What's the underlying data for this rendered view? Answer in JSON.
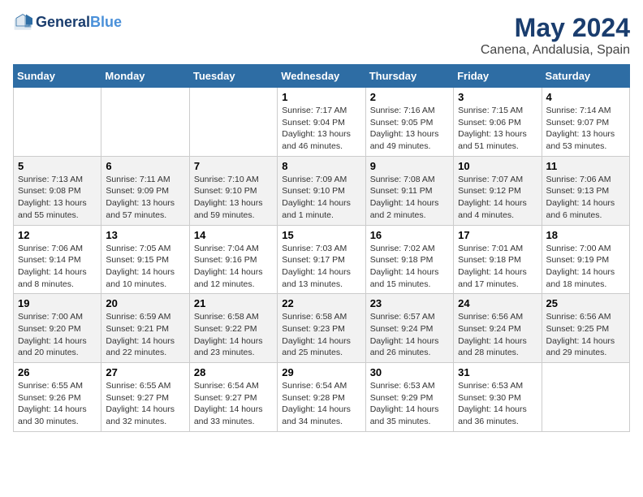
{
  "header": {
    "logo_line1": "General",
    "logo_line2": "Blue",
    "month": "May 2024",
    "location": "Canena, Andalusia, Spain"
  },
  "weekdays": [
    "Sunday",
    "Monday",
    "Tuesday",
    "Wednesday",
    "Thursday",
    "Friday",
    "Saturday"
  ],
  "weeks": [
    [
      {
        "day": "",
        "sunrise": "",
        "sunset": "",
        "daylight": ""
      },
      {
        "day": "",
        "sunrise": "",
        "sunset": "",
        "daylight": ""
      },
      {
        "day": "",
        "sunrise": "",
        "sunset": "",
        "daylight": ""
      },
      {
        "day": "1",
        "sunrise": "Sunrise: 7:17 AM",
        "sunset": "Sunset: 9:04 PM",
        "daylight": "Daylight: 13 hours and 46 minutes."
      },
      {
        "day": "2",
        "sunrise": "Sunrise: 7:16 AM",
        "sunset": "Sunset: 9:05 PM",
        "daylight": "Daylight: 13 hours and 49 minutes."
      },
      {
        "day": "3",
        "sunrise": "Sunrise: 7:15 AM",
        "sunset": "Sunset: 9:06 PM",
        "daylight": "Daylight: 13 hours and 51 minutes."
      },
      {
        "day": "4",
        "sunrise": "Sunrise: 7:14 AM",
        "sunset": "Sunset: 9:07 PM",
        "daylight": "Daylight: 13 hours and 53 minutes."
      }
    ],
    [
      {
        "day": "5",
        "sunrise": "Sunrise: 7:13 AM",
        "sunset": "Sunset: 9:08 PM",
        "daylight": "Daylight: 13 hours and 55 minutes."
      },
      {
        "day": "6",
        "sunrise": "Sunrise: 7:11 AM",
        "sunset": "Sunset: 9:09 PM",
        "daylight": "Daylight: 13 hours and 57 minutes."
      },
      {
        "day": "7",
        "sunrise": "Sunrise: 7:10 AM",
        "sunset": "Sunset: 9:10 PM",
        "daylight": "Daylight: 13 hours and 59 minutes."
      },
      {
        "day": "8",
        "sunrise": "Sunrise: 7:09 AM",
        "sunset": "Sunset: 9:10 PM",
        "daylight": "Daylight: 14 hours and 1 minute."
      },
      {
        "day": "9",
        "sunrise": "Sunrise: 7:08 AM",
        "sunset": "Sunset: 9:11 PM",
        "daylight": "Daylight: 14 hours and 2 minutes."
      },
      {
        "day": "10",
        "sunrise": "Sunrise: 7:07 AM",
        "sunset": "Sunset: 9:12 PM",
        "daylight": "Daylight: 14 hours and 4 minutes."
      },
      {
        "day": "11",
        "sunrise": "Sunrise: 7:06 AM",
        "sunset": "Sunset: 9:13 PM",
        "daylight": "Daylight: 14 hours and 6 minutes."
      }
    ],
    [
      {
        "day": "12",
        "sunrise": "Sunrise: 7:06 AM",
        "sunset": "Sunset: 9:14 PM",
        "daylight": "Daylight: 14 hours and 8 minutes."
      },
      {
        "day": "13",
        "sunrise": "Sunrise: 7:05 AM",
        "sunset": "Sunset: 9:15 PM",
        "daylight": "Daylight: 14 hours and 10 minutes."
      },
      {
        "day": "14",
        "sunrise": "Sunrise: 7:04 AM",
        "sunset": "Sunset: 9:16 PM",
        "daylight": "Daylight: 14 hours and 12 minutes."
      },
      {
        "day": "15",
        "sunrise": "Sunrise: 7:03 AM",
        "sunset": "Sunset: 9:17 PM",
        "daylight": "Daylight: 14 hours and 13 minutes."
      },
      {
        "day": "16",
        "sunrise": "Sunrise: 7:02 AM",
        "sunset": "Sunset: 9:18 PM",
        "daylight": "Daylight: 14 hours and 15 minutes."
      },
      {
        "day": "17",
        "sunrise": "Sunrise: 7:01 AM",
        "sunset": "Sunset: 9:18 PM",
        "daylight": "Daylight: 14 hours and 17 minutes."
      },
      {
        "day": "18",
        "sunrise": "Sunrise: 7:00 AM",
        "sunset": "Sunset: 9:19 PM",
        "daylight": "Daylight: 14 hours and 18 minutes."
      }
    ],
    [
      {
        "day": "19",
        "sunrise": "Sunrise: 7:00 AM",
        "sunset": "Sunset: 9:20 PM",
        "daylight": "Daylight: 14 hours and 20 minutes."
      },
      {
        "day": "20",
        "sunrise": "Sunrise: 6:59 AM",
        "sunset": "Sunset: 9:21 PM",
        "daylight": "Daylight: 14 hours and 22 minutes."
      },
      {
        "day": "21",
        "sunrise": "Sunrise: 6:58 AM",
        "sunset": "Sunset: 9:22 PM",
        "daylight": "Daylight: 14 hours and 23 minutes."
      },
      {
        "day": "22",
        "sunrise": "Sunrise: 6:58 AM",
        "sunset": "Sunset: 9:23 PM",
        "daylight": "Daylight: 14 hours and 25 minutes."
      },
      {
        "day": "23",
        "sunrise": "Sunrise: 6:57 AM",
        "sunset": "Sunset: 9:24 PM",
        "daylight": "Daylight: 14 hours and 26 minutes."
      },
      {
        "day": "24",
        "sunrise": "Sunrise: 6:56 AM",
        "sunset": "Sunset: 9:24 PM",
        "daylight": "Daylight: 14 hours and 28 minutes."
      },
      {
        "day": "25",
        "sunrise": "Sunrise: 6:56 AM",
        "sunset": "Sunset: 9:25 PM",
        "daylight": "Daylight: 14 hours and 29 minutes."
      }
    ],
    [
      {
        "day": "26",
        "sunrise": "Sunrise: 6:55 AM",
        "sunset": "Sunset: 9:26 PM",
        "daylight": "Daylight: 14 hours and 30 minutes."
      },
      {
        "day": "27",
        "sunrise": "Sunrise: 6:55 AM",
        "sunset": "Sunset: 9:27 PM",
        "daylight": "Daylight: 14 hours and 32 minutes."
      },
      {
        "day": "28",
        "sunrise": "Sunrise: 6:54 AM",
        "sunset": "Sunset: 9:27 PM",
        "daylight": "Daylight: 14 hours and 33 minutes."
      },
      {
        "day": "29",
        "sunrise": "Sunrise: 6:54 AM",
        "sunset": "Sunset: 9:28 PM",
        "daylight": "Daylight: 14 hours and 34 minutes."
      },
      {
        "day": "30",
        "sunrise": "Sunrise: 6:53 AM",
        "sunset": "Sunset: 9:29 PM",
        "daylight": "Daylight: 14 hours and 35 minutes."
      },
      {
        "day": "31",
        "sunrise": "Sunrise: 6:53 AM",
        "sunset": "Sunset: 9:30 PM",
        "daylight": "Daylight: 14 hours and 36 minutes."
      },
      {
        "day": "",
        "sunrise": "",
        "sunset": "",
        "daylight": ""
      }
    ]
  ]
}
